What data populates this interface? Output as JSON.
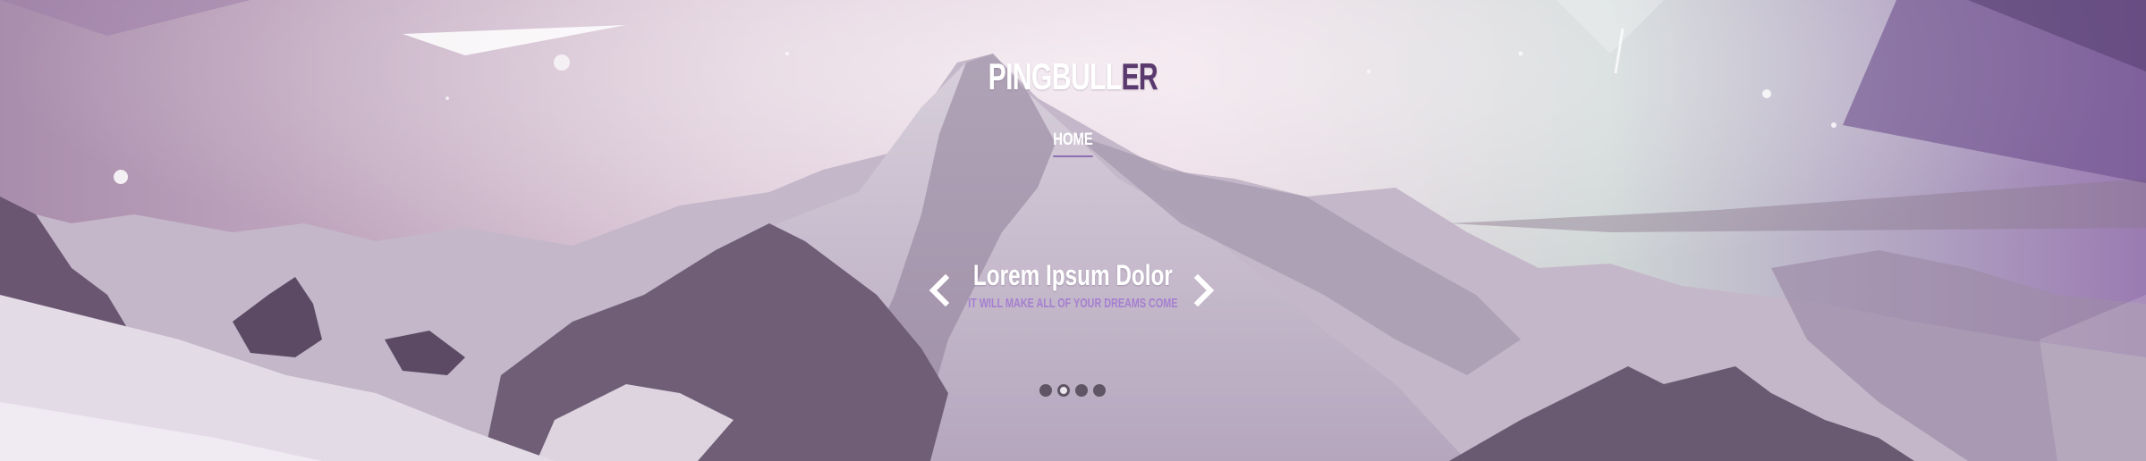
{
  "brand": {
    "logo_main": "PINGBULL",
    "logo_accent": "ER",
    "accent_color": "#5a3a6e"
  },
  "nav": {
    "items": [
      {
        "label": "HOME",
        "active": true
      }
    ],
    "underline_color": "#8e6fb0"
  },
  "slider": {
    "title": "Lorem Ipsum Dolor",
    "subtitle": "IT WILL MAKE ALL OF YOUR DREAMS COME",
    "subtitle_color": "#a57fd0",
    "prev_icon": "chevron-left-icon",
    "next_icon": "chevron-right-icon",
    "dots_total": 4,
    "active_dot": 2
  }
}
